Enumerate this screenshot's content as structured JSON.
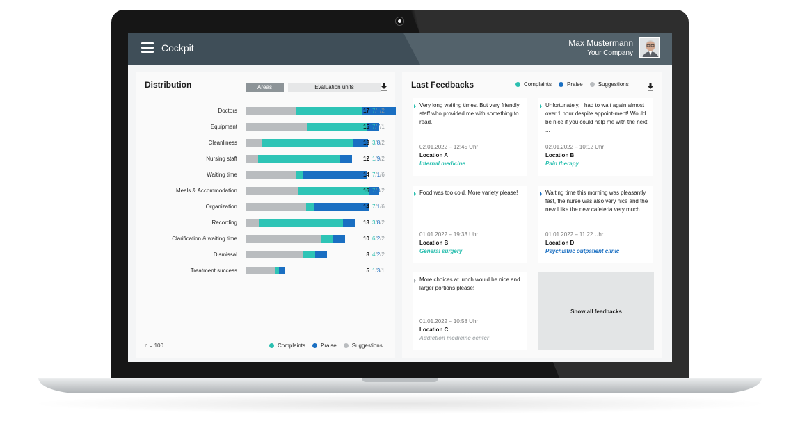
{
  "header": {
    "app_title": "Cockpit",
    "user_name": "Max Mustermann",
    "user_company": "Your Company"
  },
  "colors": {
    "complaints": "#2ec4b6",
    "praise": "#1a73c6",
    "suggestions": "#b9bcbf"
  },
  "distribution": {
    "title": "Distribution",
    "toggle": {
      "areas": "Areas",
      "units": "Evaluation units",
      "selected": "Areas"
    },
    "n_label": "n = 100",
    "legend": [
      "Complaints",
      "Praise",
      "Suggestions"
    ],
    "rows": [
      {
        "label": "Doctors",
        "total": "17",
        "c": "7",
        "p": "8",
        "s": "2",
        "bar": {
          "suggestions": 0.33,
          "complaints": 0.44,
          "praise": 0.23
        }
      },
      {
        "label": "Equipment",
        "total": "15",
        "c": "7",
        "p": "7",
        "s": "1",
        "bar": {
          "suggestions": 0.41,
          "complaints": 0.4,
          "praise": 0.08
        }
      },
      {
        "label": "Cleanliness",
        "total": "13",
        "c": "3",
        "p": "8",
        "s": "2",
        "bar": {
          "suggestions": 0.1,
          "complaints": 0.61,
          "praise": 0.1
        }
      },
      {
        "label": "Nursing staff",
        "total": "12",
        "c": "1",
        "p": "9",
        "s": "2",
        "bar": {
          "suggestions": 0.08,
          "complaints": 0.55,
          "praise": 0.08
        }
      },
      {
        "label": "Waiting time",
        "total": "14",
        "c": "7",
        "p": "1",
        "s": "6",
        "bar": {
          "suggestions": 0.33,
          "complaints": 0.05,
          "praise": 0.43
        }
      },
      {
        "label": "Meals & Accommodation",
        "total": "16",
        "c": "7",
        "p": "8",
        "s": "2",
        "bar": {
          "suggestions": 0.35,
          "complaints": 0.47,
          "praise": 0.07
        }
      },
      {
        "label": "Organization",
        "total": "14",
        "c": "7",
        "p": "1",
        "s": "6",
        "bar": {
          "suggestions": 0.4,
          "complaints": 0.05,
          "praise": 0.37
        }
      },
      {
        "label": "Recording",
        "total": "13",
        "c": "3",
        "p": "8",
        "s": "2",
        "bar": {
          "suggestions": 0.09,
          "complaints": 0.56,
          "praise": 0.08
        }
      },
      {
        "label": "Clarification & waiting time",
        "total": "10",
        "c": "6",
        "p": "2",
        "s": "2",
        "bar": {
          "suggestions": 0.5,
          "complaints": 0.08,
          "praise": 0.08
        }
      },
      {
        "label": "Dismissal",
        "total": "8",
        "c": "4",
        "p": "2",
        "s": "2",
        "bar": {
          "suggestions": 0.38,
          "complaints": 0.08,
          "praise": 0.08
        }
      },
      {
        "label": "Treatment success",
        "total": "5",
        "c": "1",
        "p": "3",
        "s": "1",
        "bar": {
          "suggestions": 0.19,
          "complaints": 0.03,
          "praise": 0.04
        }
      }
    ]
  },
  "feedbacks": {
    "title": "Last Feedbacks",
    "legend": [
      "Complaints",
      "Praise",
      "Suggestions"
    ],
    "show_all": "Show all feedbacks",
    "cards": [
      {
        "text": "Very long waiting times. But very friendly staff who provided me with something to read.",
        "date": "02.01.2022 – 12:45 Uhr",
        "location": "Location A",
        "department": "Internal medicine",
        "dept_color": "#2bbfb0"
      },
      {
        "text": "Unfortunately, I had to wait again almost over 1 hour despite appoint-ment! Would be nice if you could help me with the next ...",
        "date": "02.01.2022 – 10:12 Uhr",
        "location": "Location B",
        "department": "Pain therapy",
        "dept_color": "#2bbfb0"
      },
      {
        "text": "Food was too cold. More variety please!",
        "date": "01.01.2022 – 19:33 Uhr",
        "location": "Location B",
        "department": "General surgery",
        "dept_color": "#2bbfb0"
      },
      {
        "text": "Waiting time this morning was pleasantly fast, the nurse was also very nice and the new I like the new cafeteria very much.",
        "date": "01.01.2022 – 11:22 Uhr",
        "location": "Location D",
        "department": "Psychiatric outpatient clinic",
        "dept_color": "#1a73c6"
      },
      {
        "text": "More choices at lunch would be nice and larger portions please!",
        "date": "01.01.2022 – 10:58 Uhr",
        "location": "Location C",
        "department": "Addiction medicine center",
        "dept_color": "#a9aeb1"
      }
    ]
  }
}
